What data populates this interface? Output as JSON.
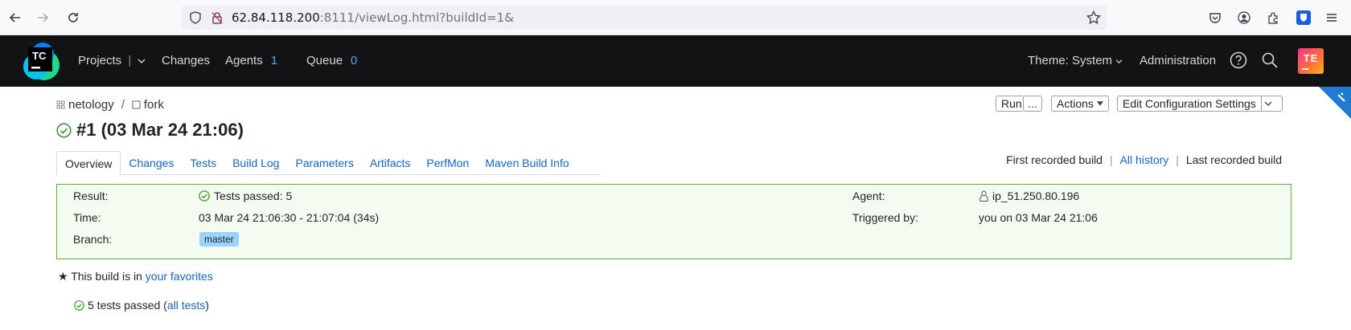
{
  "browser": {
    "url_host": "62.84.118.200",
    "url_rest": ":8111/viewLog.html?buildId=1&"
  },
  "header": {
    "logo_text": "TC",
    "projects": "Projects",
    "changes": "Changes",
    "agents_label": "Agents",
    "agents_count": "1",
    "queue_label": "Queue",
    "queue_count": "0",
    "theme": "Theme: System",
    "administration": "Administration",
    "avatar": "TE"
  },
  "breadcrumb": {
    "project": "netology",
    "separator": "/",
    "config": "fork"
  },
  "actions": {
    "run": "Run",
    "run_more": "...",
    "actions": "Actions",
    "edit": "Edit Configuration Settings"
  },
  "build": {
    "title": "#1 (03 Mar 24 21:06)"
  },
  "tabs": [
    "Overview",
    "Changes",
    "Tests",
    "Build Log",
    "Parameters",
    "Artifacts",
    "PerfMon",
    "Maven Build Info"
  ],
  "history": {
    "first": "First recorded build",
    "all": "All history",
    "last": "Last recorded build",
    "sep": "|"
  },
  "summary": {
    "result_label": "Result:",
    "result_value": "Tests passed: 5",
    "time_label": "Time:",
    "time_value": "03 Mar 24 21:06:30 - 21:07:04 (34s)",
    "branch_label": "Branch:",
    "branch_value": "master",
    "agent_label": "Agent:",
    "agent_value": "ip_51.250.80.196",
    "triggered_label": "Triggered by:",
    "triggered_value": "you on 03 Mar 24 21:06"
  },
  "favorites": {
    "prefix": "This build is in",
    "link": "your favorites"
  },
  "tests": {
    "text": "5 tests passed (",
    "link": "all tests",
    "close": ")"
  },
  "colors": {
    "accent": "#1565c0",
    "success": "#57b33b",
    "header_bg": "#121314"
  }
}
